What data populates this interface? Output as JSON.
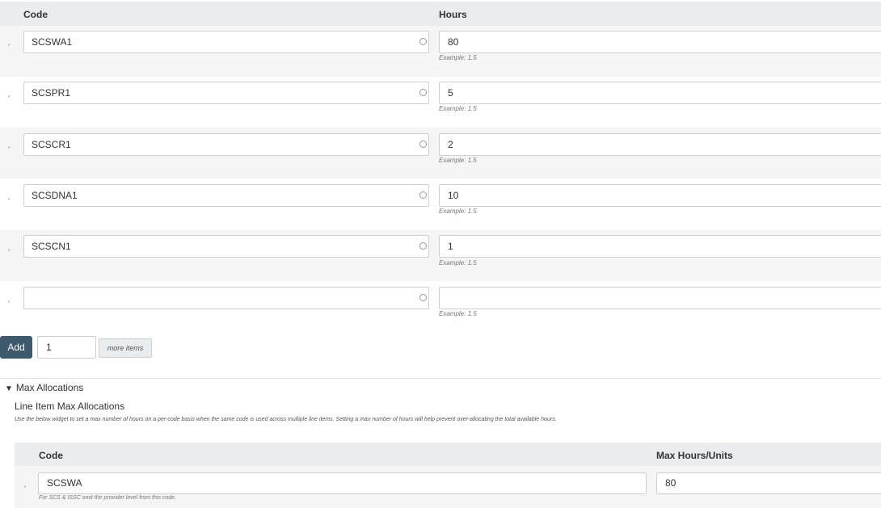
{
  "table": {
    "code_header": "Code",
    "hours_header": "Hours",
    "rows": [
      {
        "code": "SCSWA1",
        "hours": "80",
        "hint": "Example: 1.5"
      },
      {
        "code": "SCSPR1",
        "hours": "5",
        "hint": "Example: 1.5"
      },
      {
        "code": "SCSCR1",
        "hours": "2",
        "hint": "Example: 1.5"
      },
      {
        "code": "SCSDNA1",
        "hours": "10",
        "hint": "Example: 1.5"
      },
      {
        "code": "SCSCN1",
        "hours": "1",
        "hint": "Example: 1.5"
      },
      {
        "code": "",
        "hours": "",
        "hint": "Example: 1.5"
      }
    ]
  },
  "add_controls": {
    "add_label": "Add",
    "count_value": "1",
    "more_items_label": "more items"
  },
  "max_allocations": {
    "summary": "Max Allocations",
    "title": "Line Item Max Allocations",
    "description": "Use the below widget to set a max number of hours on a per-code basis when the same code is used across multiple line items. Setting a max number of hours will help prevent over-allocating the total available hours.",
    "code_header": "Code",
    "hours_header": "Max Hours/Units",
    "rows": [
      {
        "code": "SCSWA",
        "hours": "80",
        "hint": "For SCS & ISSC omit the provider level from this code."
      }
    ]
  },
  "icons": {
    "drag_handle": "drag-handle-icon",
    "circle": "autocomplete-circle-icon",
    "disclosure": "triangle-down-icon"
  }
}
